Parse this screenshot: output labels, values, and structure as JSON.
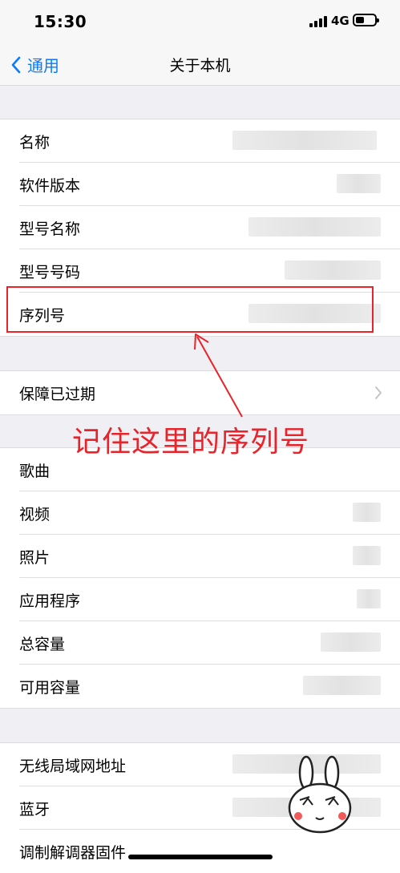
{
  "status_bar": {
    "time": "15:30",
    "network": "4G"
  },
  "nav": {
    "back_label": "通用",
    "title": "关于本机"
  },
  "groups": {
    "info": [
      "名称",
      "软件版本",
      "型号名称",
      "型号号码",
      "序列号"
    ],
    "warranty": [
      "保障已过期"
    ],
    "media": [
      "歌曲",
      "视频",
      "照片",
      "应用程序",
      "总容量",
      "可用容量"
    ],
    "network": [
      "无线局域网地址",
      "蓝牙",
      "调制解调器固件"
    ]
  },
  "annotation": {
    "text": "记住这里的序列号",
    "color": "#e8232a"
  },
  "colors": {
    "accent": "#0a7aff",
    "background": "#efeff4"
  }
}
